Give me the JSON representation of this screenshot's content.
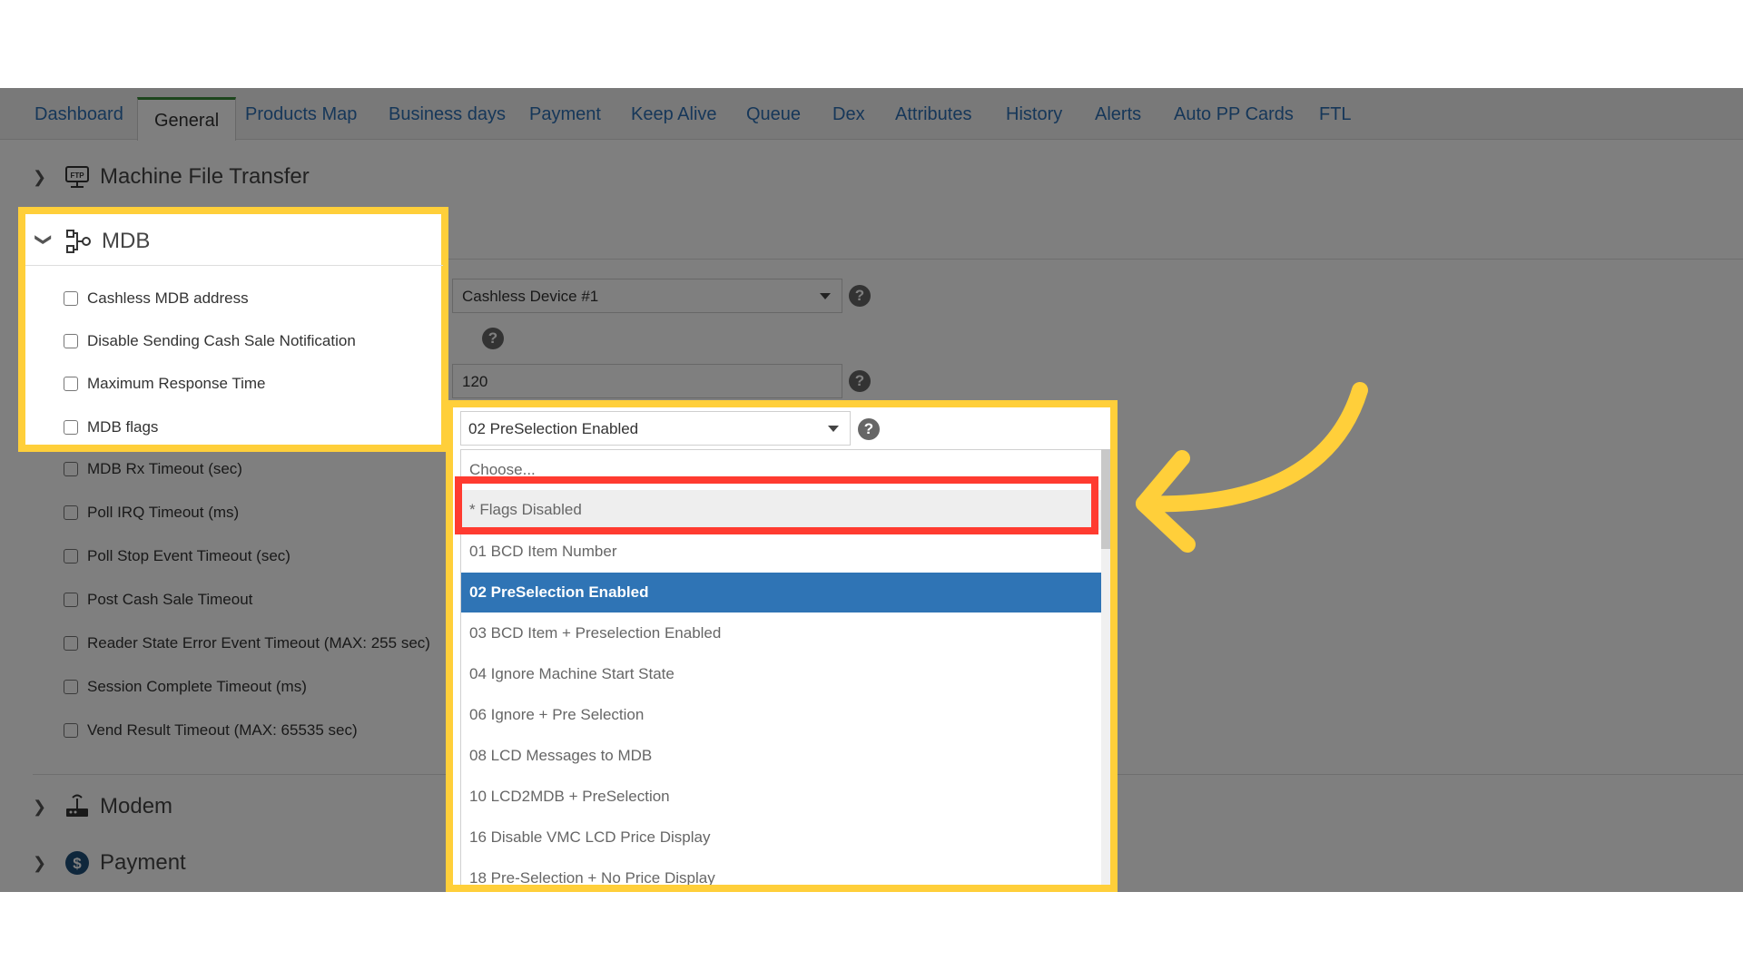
{
  "tabs": [
    "Dashboard",
    "General",
    "Products Map",
    "Business days",
    "Payment",
    "Keep Alive",
    "Queue",
    "Dex",
    "Attributes",
    "History",
    "Alerts",
    "Auto PP Cards",
    "FTL"
  ],
  "active_tab": "General",
  "sections": {
    "machine_file_transfer": "Machine File Transfer",
    "mdb": "MDB",
    "modem": "Modem",
    "payment": "Payment"
  },
  "mdb_fields": [
    "Cashless MDB address",
    "Disable Sending Cash Sale Notification",
    "Maximum Response Time",
    "MDB flags",
    "MDB Rx Timeout (sec)",
    "Poll IRQ Timeout (ms)",
    "Poll Stop Event Timeout (sec)",
    "Post Cash Sale Timeout",
    "Reader State Error Event Timeout (MAX: 255 sec)",
    "Session Complete Timeout (ms)",
    "Vend Result Timeout (MAX: 65535 sec)"
  ],
  "values": {
    "cashless_device": "Cashless Device #1",
    "max_response_time": "120",
    "mdb_flags_selected": "02 PreSelection Enabled"
  },
  "dropdown": {
    "options": [
      "Choose...",
      "* Flags Disabled",
      "01 BCD Item Number",
      "02 PreSelection Enabled",
      "03 BCD Item + Preselection Enabled",
      "04 Ignore Machine Start State",
      "06 Ignore + Pre Selection",
      "08 LCD Messages to MDB",
      "10 LCD2MDB + PreSelection",
      "16 Disable VMC LCD Price Display",
      "18 Pre-Selection + No Price Display"
    ],
    "highlighted_option": "* Flags Disabled",
    "selected_option": "02 PreSelection Enabled"
  },
  "icons": {
    "collapsed": "chevron-right-icon",
    "expanded": "chevron-down-icon",
    "help": "question-circle-icon"
  },
  "colors": {
    "highlight_frame": "#ffcf3a",
    "callout_box": "#ff3b30",
    "selected_option": "#2f74b5",
    "tab_link": "#2d6fb3",
    "active_tab_indicator": "#3a8a3a"
  }
}
